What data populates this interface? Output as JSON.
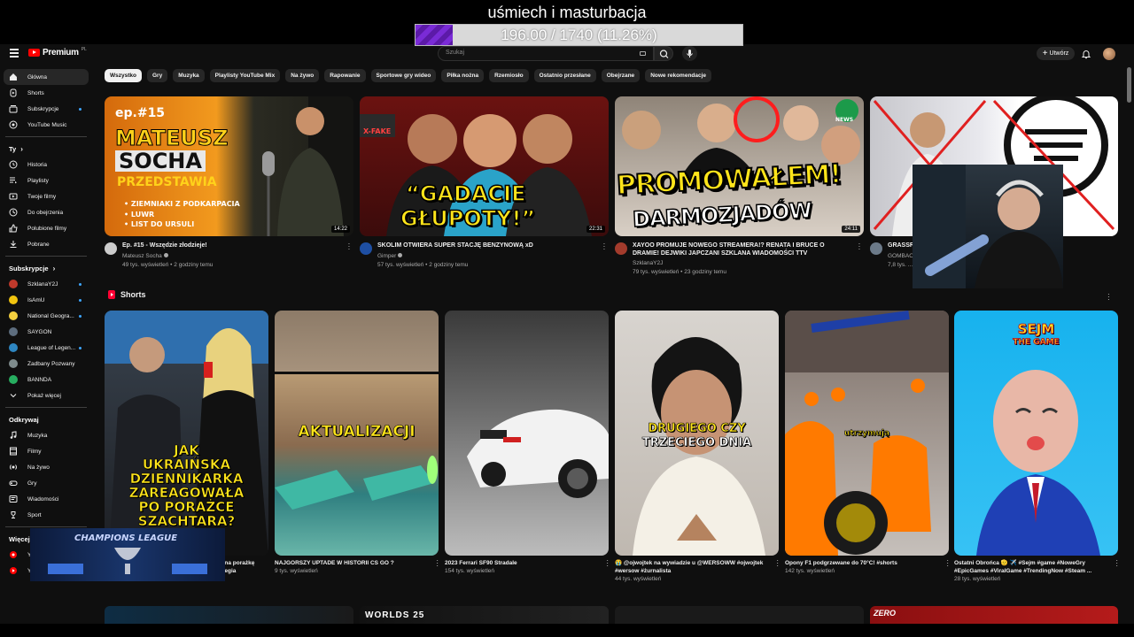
{
  "overlay": {
    "title": "uśmiech i masturbacja",
    "goal_text": "196.00 / 1740 (11.26%)",
    "goal_fraction": 0.1126
  },
  "header": {
    "brand": "Premium",
    "brand_region": "PL",
    "search_placeholder": "Szukaj",
    "create_label": "Utwórz"
  },
  "sidebar": {
    "main": [
      {
        "label": "Główna",
        "icon": "home-icon",
        "active": true
      },
      {
        "label": "Shorts",
        "icon": "shorts-icon"
      },
      {
        "label": "Subskrypcje",
        "icon": "subscriptions-icon",
        "dot": true
      },
      {
        "label": "YouTube Music",
        "icon": "music-icon"
      }
    ],
    "you_heading": "Ty",
    "you": [
      {
        "label": "Historia",
        "icon": "history-icon"
      },
      {
        "label": "Playlisty",
        "icon": "playlists-icon"
      },
      {
        "label": "Twoje filmy",
        "icon": "your-videos-icon"
      },
      {
        "label": "Do obejrzenia",
        "icon": "watch-later-icon"
      },
      {
        "label": "Polubione filmy",
        "icon": "liked-icon"
      },
      {
        "label": "Pobrane",
        "icon": "downloads-icon"
      }
    ],
    "subs_heading": "Subskrypcje",
    "subs": [
      {
        "label": "SzklanaY2J",
        "color": "#c0392b",
        "dot": true
      },
      {
        "label": "IsAmU",
        "color": "#f1c40f",
        "dot": true
      },
      {
        "label": "National Geogra...",
        "color": "#f4d03f",
        "dot": true
      },
      {
        "label": "SAYGON",
        "color": "#5d6d7e"
      },
      {
        "label": "League of Legen...",
        "color": "#2e86c1",
        "dot": true
      },
      {
        "label": "Zadbany Pozwany",
        "color": "#7f8c8d"
      },
      {
        "label": "BANNDA",
        "color": "#27ae60"
      },
      {
        "label": "Pokaż więcej",
        "icon": "chevron-down-icon"
      }
    ],
    "explore_heading": "Odkrywaj",
    "explore": [
      {
        "label": "Muzyka",
        "icon": "music-note-icon"
      },
      {
        "label": "Filmy",
        "icon": "film-icon"
      },
      {
        "label": "Na żywo",
        "icon": "live-icon"
      },
      {
        "label": "Gry",
        "icon": "gaming-icon"
      },
      {
        "label": "Wiadomości",
        "icon": "news-icon"
      },
      {
        "label": "Sport",
        "icon": "trophy-icon"
      }
    ],
    "more_heading": "Więcej z",
    "more": [
      {
        "label": "YouTube Music",
        "icon": "yt-music-icon"
      },
      {
        "label": "YouTube Kids",
        "icon": "yt-kids-icon"
      }
    ]
  },
  "chips": [
    "Wszystko",
    "Gry",
    "Muzyka",
    "Playlisty YouTube Mix",
    "Na żywo",
    "Rapowanie",
    "Sportowe gry wideo",
    "Piłka nożna",
    "Rzemiosło",
    "Ostatnio przesłane",
    "Obejrzane",
    "Nowe rekomendacje"
  ],
  "videos": [
    {
      "title": "Ep. #15 - Wszędzie złodzieje!",
      "channel": "Mateusz Socha",
      "verified": true,
      "stats": "49 tys. wyświetleń • 2 godziny temu",
      "duration": "14:22",
      "thumb_lines": [
        "ep.#15",
        "MATEUSZ",
        "SOCHA",
        "PRZEDSTAWIA",
        "• ZIEMNIAKI Z PODKARPACIA",
        "• LUWR",
        "• LIST DO URSULI"
      ]
    },
    {
      "title": "SKOLIM OTWIERA SUPER STACJĘ BENZYNOWĄ xD",
      "channel": "Gimper",
      "verified": true,
      "stats": "57 tys. wyświetleń • 2 godziny temu",
      "duration": "22:31",
      "thumb_lines": [
        "“GADACIE",
        "GŁUPOTY!”",
        "X-FAKE",
        "NEWS"
      ]
    },
    {
      "title": "XAYOO PROMUJE NOWEGO STREAMERA!? RENATA I BRUCE O DRAMIE! DEJWIKI JAPCZANI SZKLANA WIADOMOŚCI TTV",
      "channel": "SzklanaY2J",
      "verified": false,
      "stats": "79 tys. wyświetleń • 23 godziny temu",
      "duration": "24:11",
      "thumb_lines": [
        "PROMOWAŁEM!",
        "DARMOZJADÓW",
        "NEWS"
      ]
    },
    {
      "title": "GRASSR...",
      "channel": "GOMBAO...",
      "verified": false,
      "stats": "7,8 tys. ...",
      "duration": ""
    }
  ],
  "shorts_heading": "Shorts",
  "shorts": [
    {
      "title": "...na porażkę #legia",
      "views": "",
      "caption": [
        "JAK",
        "UKRAIŃSKA",
        "DZIENNIKARKA",
        "ZAREAGOWAŁA",
        "PO PORAŻCE",
        "SZACHTARA?"
      ]
    },
    {
      "title": "NAJGORSZY UPTADE W HISTORII CS GO ?",
      "views": "9 tys. wyświetleń",
      "caption": [
        "AKTUALIZACJI"
      ]
    },
    {
      "title": "2023 Ferrari SF90 Stradale",
      "views": "154 tys. wyświetleń",
      "caption": []
    },
    {
      "title": "😭 @ojwojtek na wywiadzie u @WERSOWW #ojwojtek #wersow #żurnalista",
      "views": "44 tys. wyświetleń",
      "caption": [
        "DRUGIEGO CZY",
        "TRZECIEGO DNIA"
      ]
    },
    {
      "title": "Opony F1 podgrzewane do 70°C! #shorts",
      "views": "142 tys. wyświetleń",
      "caption": [
        "utrzymują"
      ]
    },
    {
      "title": "Ostatni Obrońca 🫡 ✈️ #Sejm #game #NoweGry #EpicGames #ViralGame #TrendingNow #Steam ...",
      "views": "28 tys. wyświetleń",
      "caption": [
        "SEJM",
        "THE GAME"
      ]
    }
  ],
  "webcam_overlay": {
    "banner": "CHAMPIONS LEAGUE"
  },
  "peek_labels": [
    "WORLDS 25",
    "ZERO"
  ],
  "colors": {
    "bg": "#0f0f0f",
    "chip": "#272727",
    "accent_red": "#ff0000",
    "goal_purple": "#7a2bd6"
  }
}
